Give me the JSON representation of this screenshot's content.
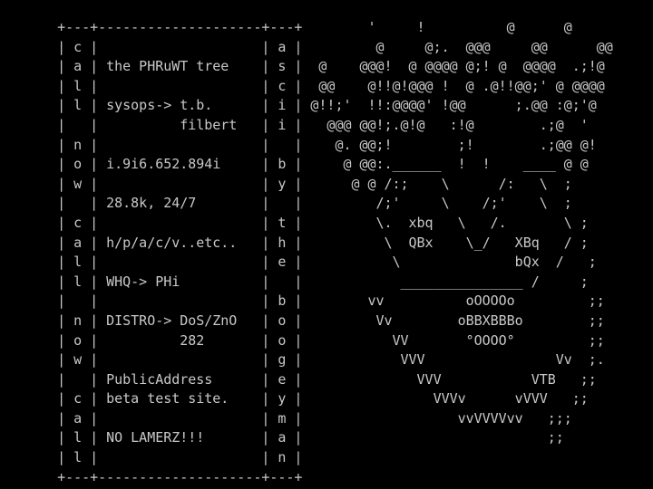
{
  "screen": {
    "foreground": "#c8c8c8",
    "background": "#000000",
    "lines": [
      "       +---+--------------------+---+        '     !          @      @",
      "       | c |                    | a |         @     @;.  @@@     @@      @@",
      "       | a | the PHRuWT tree    | s |  @    @@@!  @ @@@@ @;! @  @@@@  .;!@",
      "       | l |                    | c |  @@    @!!@!@@@ !  @ .@!!@@;' @ @@@@",
      "       | l | sysops-> t.b.      | i | @!!;'  !!:@@@@' !@@      ;.@@ :@;'@",
      "       |   |          filbert   | i |   @@@ @@!;.@!@   :!@        .;@  '",
      "       | n |                    |   |    @. @@;!        ;!        .;@@ @!",
      "       | o | i.9i6.652.894i     | b |     @ @@:.______  !  !    ____ @ @",
      "       | w |                    | y |      @ @ /:;    \\      /:   \\  ;",
      "       |   | 28.8k, 24/7        |   |         /;'     \\    /;'    \\  ;",
      "       | c |                    | t |         \\.  xbq   \\   /.       \\ ;",
      "       | a | h/p/a/c/v..etc..   | h |          \\  QBx    \\_/   XBq   / ;",
      "       | l |                    | e |           \\              bQx  /   ;",
      "       | l | WHQ-> PHi          |   |            _______________ /     ;",
      "       |   |                    | b |        vv          oOOOOo         ;;",
      "       | n | DISTRO-> DoS/ZnO   | o |         Vv        oBBXBBBo        ;;",
      "       | o |          282       | o |           VV       °OOOO°         ;;",
      "       | w |                    | g |            VVV                Vv  ;.",
      "       |   | PublicAddress      | e |              VVV           VTB   ;;",
      "       | c | beta test site.    | y |                VVVv      vVVV   ;;",
      "       | a |                    | m |                   vvVVVVvv   ;;;",
      "       | l | NO LAMERZ!!!       | a |                              ;;",
      "       | l |                    | n |",
      "       +---+--------------------+---+"
    ]
  }
}
